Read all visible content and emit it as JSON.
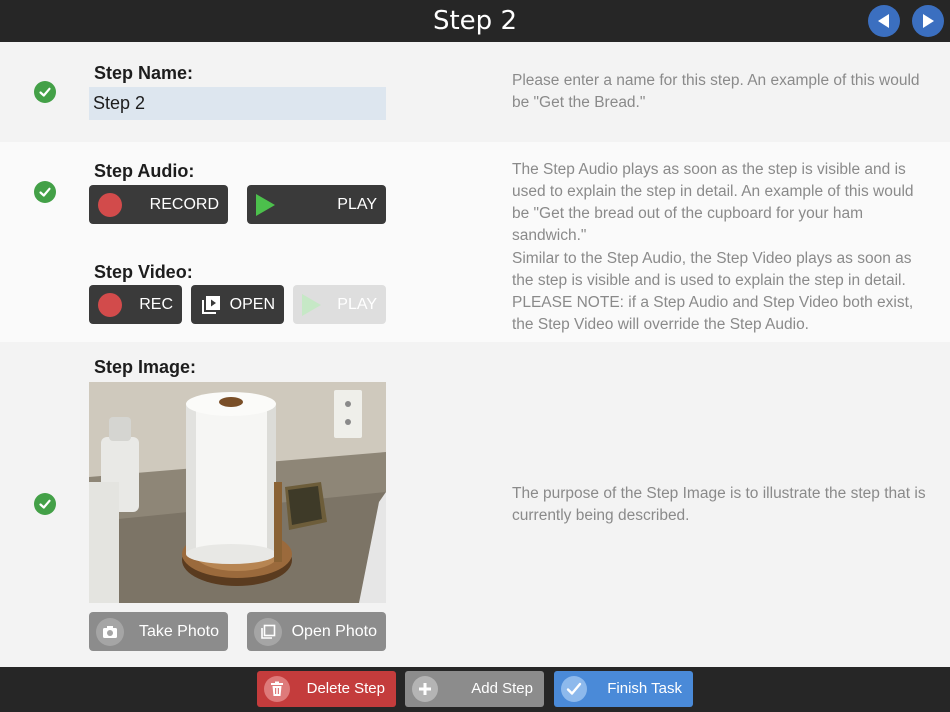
{
  "header": {
    "title": "Step 2",
    "back_icon": "arrow-left-icon",
    "forward_icon": "arrow-right-icon",
    "accent_color": "#3b6fc0"
  },
  "step_name": {
    "label": "Step Name:",
    "value": "Step 2",
    "description": "Please enter a name for this step.  An example of this would be \"Get the Bread.\""
  },
  "step_audio": {
    "label": "Step Audio:",
    "record_label": "RECORD",
    "play_label": "PLAY",
    "description": "The Step Audio plays as soon as the step is visible and is used to explain the step in detail.  An example of this would be \"Get the bread out of the cupboard for your ham sandwich.\""
  },
  "step_video": {
    "label": "Step Video:",
    "rec_label": "REC",
    "open_label": "OPEN",
    "play_label": "PLAY",
    "description": "Similar to the Step Audio, the Step Video plays as soon as the step is visible and is used to explain the step in detail. PLEASE NOTE: if a Step Audio and Step Video both exist, the Step Video will override the Step Audio."
  },
  "step_image": {
    "label": "Step Image:",
    "take_photo_label": "Take Photo",
    "open_photo_label": "Open Photo",
    "description": "The purpose of the Step Image is to illustrate the step that is currently being described."
  },
  "footer": {
    "delete_label": "Delete Step",
    "add_label": "Add Step",
    "finish_label": "Finish Task",
    "delete_color": "#c43c3c",
    "add_color": "#8c8c8c",
    "finish_color": "#4a8ad8"
  },
  "colors": {
    "check": "#43a047",
    "record": "#d24b4b",
    "play": "#4cc04c"
  }
}
